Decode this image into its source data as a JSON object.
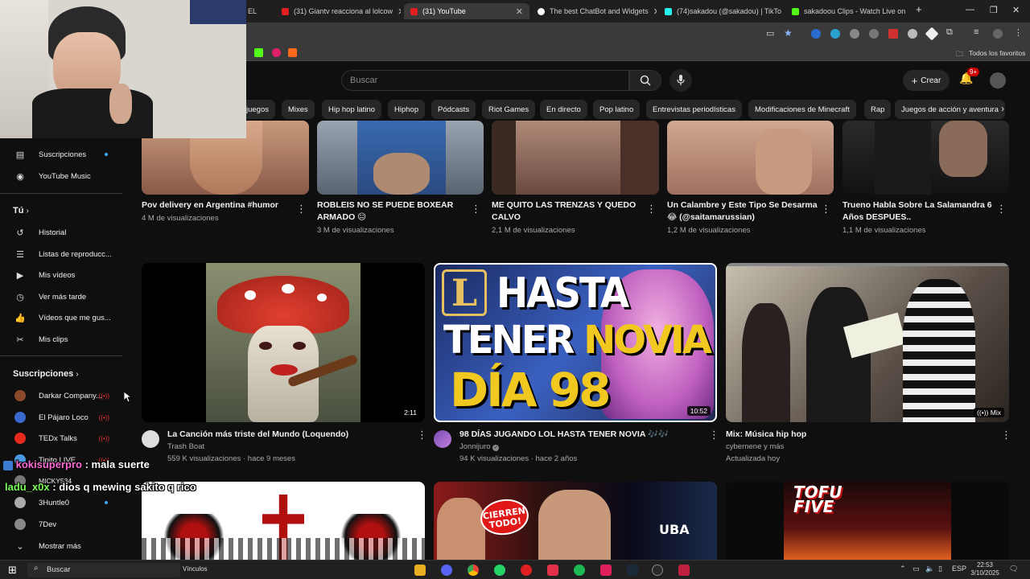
{
  "browser": {
    "tabs": [
      {
        "label": "EL",
        "favicon_color": "#e02020",
        "active": false
      },
      {
        "label": "(31) Giantv reacciona al lolcow",
        "favicon_color": "#e02020",
        "active": false
      },
      {
        "label": "(31) YouTube",
        "favicon_color": "#e02020",
        "active": true
      },
      {
        "label": "The best ChatBot and Widgets",
        "favicon_color": "#ffffff",
        "active": false
      },
      {
        "label": "(74)sakadou (@sakadou) | TikTo",
        "favicon_color": "#25f4ee",
        "active": false
      },
      {
        "label": "sakadoou Clips - Watch Live on",
        "favicon_color": "#53fc18",
        "active": false
      }
    ],
    "new_tab": "+",
    "bookmarks_folder": "Todos los favoritos"
  },
  "youtube": {
    "search_placeholder": "Buscar",
    "create_label": "Crear",
    "notification_badge": "9+",
    "chips": [
      "juegos",
      "Mixes",
      "Hip hop latino",
      "Hiphop",
      "Pódcasts",
      "Riot Games",
      "En directo",
      "Pop latino",
      "Entrevistas periodísticas",
      "Modificaciones de Minecraft",
      "Rap",
      "Juegos de acción y aventura"
    ]
  },
  "sidebar": {
    "top_items": [
      {
        "label": "Suscripciones",
        "icon": "subscriptions-icon",
        "dot": true
      },
      {
        "label": "YouTube Music",
        "icon": "youtube-music-icon",
        "dot": false
      }
    ],
    "you_heading": "Tú",
    "you_items": [
      {
        "label": "Historial",
        "icon": "history-icon"
      },
      {
        "label": "Listas de reproducc...",
        "icon": "playlists-icon"
      },
      {
        "label": "Mis vídeos",
        "icon": "my-videos-icon"
      },
      {
        "label": "Ver más tarde",
        "icon": "watch-later-icon"
      },
      {
        "label": "Vídeos que me gus...",
        "icon": "liked-videos-icon"
      },
      {
        "label": "Mis clips",
        "icon": "clips-icon"
      }
    ],
    "subs_heading": "Suscripciones",
    "subs_items": [
      {
        "label": "Darkar Company...",
        "color": "#8a4a2a",
        "live": true
      },
      {
        "label": "El Pájaro Loco",
        "color": "#3a6ad0",
        "live": true
      },
      {
        "label": "TEDx Talks",
        "color": "#e62b1e",
        "live": true
      },
      {
        "label": "Tipito LIVE",
        "color": "#4a9ae0",
        "live": true
      },
      {
        "label": "MICKY534",
        "color": "#777777",
        "live": false
      },
      {
        "label": "3Huntle0",
        "color": "#aaaaaa",
        "dot": true
      },
      {
        "label": "7Dev",
        "color": "#888888",
        "dot": false
      }
    ],
    "show_more": "Mostrar más"
  },
  "videos_row1": [
    {
      "title": "Pov delivery en Argentina #humor",
      "title2": "",
      "meta": "4 M de visualizaciones"
    },
    {
      "title": "ROBLEIS NO SE PUEDE BOXEAR",
      "title2": "ARMADO 😐",
      "meta": "3 M de visualizaciones"
    },
    {
      "title": "ME QUITO LAS TRENZAS Y QUEDO",
      "title2": "CALVO",
      "meta": "2,1 M de visualizaciones"
    },
    {
      "title": "Un Calambre y Este Tipo Se Desarma",
      "title2": "😂 (@saitamarussian)",
      "meta": "1,2 M de visualizaciones"
    },
    {
      "title": "Trueno Habla Sobre La Salamandra 6",
      "title2": "Años DESPUES..",
      "meta": "1,1 M de visualizaciones"
    }
  ],
  "videos_row2": [
    {
      "title": "La Canción más triste del Mundo (Loquendo)",
      "channel": "Trash Boat",
      "meta": "559 K visualizaciones · hace 9 meses",
      "duration": "2:11"
    },
    {
      "title": "98 DÍAS JUGANDO LOL HASTA TENER NOVIA 🎶🎶",
      "channel": "Jonnijuro",
      "meta": "94 K visualizaciones · hace 2 años",
      "duration": "10:52",
      "thumb_line1": "HASTA",
      "thumb_line2a": "TENER ",
      "thumb_line2b": "NOVIA",
      "thumb_line3": "DÍA 98",
      "thumb_logo": "L"
    },
    {
      "title": "Mix: Música hip hop",
      "channel": "cybernene y más",
      "meta": "Actualizada hoy",
      "duration": "Mix"
    }
  ],
  "videos_row3": [
    {
      "thumb_text": ""
    },
    {
      "thumb_text": "CIERREN TODO!",
      "sign": "UBA"
    },
    {
      "thumb_text": "TOFU FIVE"
    }
  ],
  "chat": [
    {
      "user": "kokisuperpro",
      "msg": " : mala suerte",
      "color": "#ff6bd6"
    },
    {
      "user": "ladu_x0x",
      "msg": " : dios q mewing sakito q rico",
      "color": "#7cff5a"
    }
  ],
  "taskbar": {
    "search": "Buscar",
    "vinculos": "Vínculos",
    "lang": "ESP",
    "time": "22:53",
    "date": "3/10/2025"
  }
}
